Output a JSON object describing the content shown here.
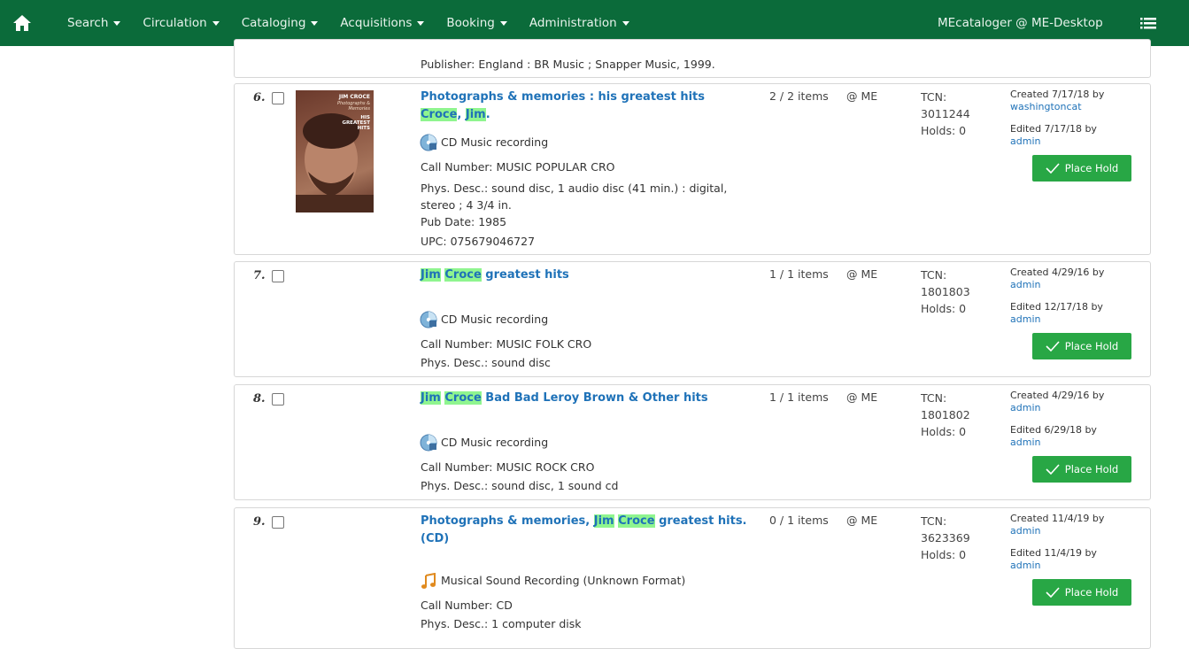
{
  "nav": {
    "menus": [
      "Search",
      "Circulation",
      "Cataloging",
      "Acquisitions",
      "Booking",
      "Administration"
    ],
    "user": "MEcataloger @ ME-Desktop"
  },
  "top_partial": {
    "publisher": "Publisher: England : BR Music ; Snapper Music, 1999."
  },
  "results": [
    {
      "num": "6.",
      "title_parts": [
        [
          "Photographs & memories : his greatest hits",
          false
        ]
      ],
      "author_parts": [
        [
          "Croce",
          true
        ],
        [
          ", ",
          false
        ],
        [
          "Jim",
          true
        ],
        [
          ".",
          false
        ]
      ],
      "format": "CD Music recording",
      "call_number": "Call Number: MUSIC POPULAR CRO",
      "phys_desc": "Phys. Desc.: sound disc, 1 audio disc (41 min.) : digital, stereo ; 4 3/4 in.",
      "pub_date": "Pub Date: 1985",
      "upc": "UPC: 075679046727",
      "items": "2 / 2 items",
      "location": "@ ME",
      "tcn_label": "TCN:",
      "tcn": "3011244",
      "holds": "Holds: 0",
      "created": "Created 7/17/18 by",
      "created_by": "washingtoncat",
      "edited": "Edited 7/17/18 by",
      "edited_by": "admin",
      "hold_label": "Place Hold",
      "cover": {
        "line1": "JIM CROCE",
        "line2": "Photographs & Memories",
        "line3": "HIS GREATEST HITS"
      }
    },
    {
      "num": "7.",
      "title_parts": [
        [
          "Jim",
          true
        ],
        [
          " ",
          false
        ],
        [
          "Croce",
          true
        ],
        [
          " greatest hits",
          false
        ]
      ],
      "format": "CD Music recording",
      "call_number": "Call Number: MUSIC FOLK CRO",
      "phys_desc": "Phys. Desc.: sound disc",
      "items": "1 / 1 items",
      "location": "@ ME",
      "tcn_label": "TCN:",
      "tcn": "1801803",
      "holds": "Holds: 0",
      "created": "Created 4/29/16 by",
      "created_by": "admin",
      "edited": "Edited 12/17/18 by",
      "edited_by": "admin",
      "hold_label": "Place Hold"
    },
    {
      "num": "8.",
      "title_parts": [
        [
          "Jim",
          true
        ],
        [
          " ",
          false
        ],
        [
          "Croce",
          true
        ],
        [
          " Bad Bad Leroy Brown & Other hits",
          false
        ]
      ],
      "format": "CD Music recording",
      "call_number": "Call Number: MUSIC ROCK CRO",
      "phys_desc": "Phys. Desc.: sound disc, 1 sound cd",
      "items": "1 / 1 items",
      "location": "@ ME",
      "tcn_label": "TCN:",
      "tcn": "1801802",
      "holds": "Holds: 0",
      "created": "Created 4/29/16 by",
      "created_by": "admin",
      "edited": "Edited 6/29/18 by",
      "edited_by": "admin",
      "hold_label": "Place Hold"
    },
    {
      "num": "9.",
      "title_parts": [
        [
          "Photographs & memories, ",
          false
        ],
        [
          "Jim",
          true
        ],
        [
          " ",
          false
        ],
        [
          "Croce",
          true
        ],
        [
          " greatest hits. (CD)",
          false
        ]
      ],
      "format": "Musical Sound Recording (Unknown Format)",
      "call_number": "Call Number: CD",
      "phys_desc": "Phys. Desc.: 1 computer disk",
      "items": "0 / 1 items",
      "location": "@ ME",
      "tcn_label": "TCN:",
      "tcn": "3623369",
      "holds": "Holds: 0",
      "created": "Created 11/4/19 by",
      "created_by": "admin",
      "edited": "Edited 11/4/19 by",
      "edited_by": "admin",
      "hold_label": "Place Hold"
    }
  ],
  "colors": {
    "nav_bg": "#0b6b3a",
    "link": "#1f72b8",
    "highlight": "#8ff58f",
    "hold_button": "#28a745"
  },
  "icons": [
    "home-icon",
    "caret-down-icon",
    "list-menu-icon",
    "cd-icon",
    "music-note-icon",
    "checkmark-icon"
  ]
}
